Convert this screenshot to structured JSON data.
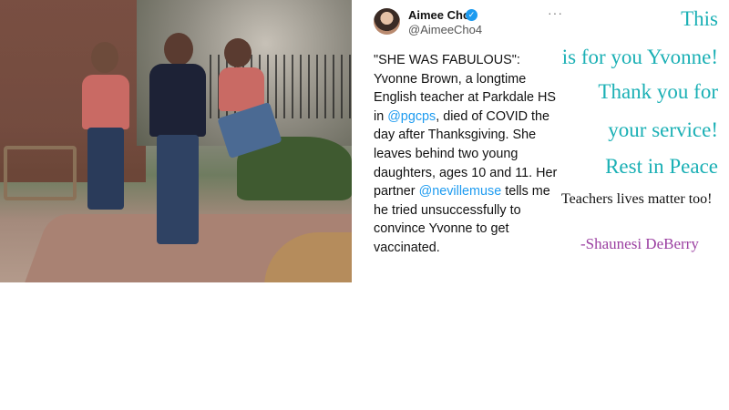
{
  "tweet": {
    "name": "Aimee Cho",
    "handle": "@AimeeCho4",
    "verified_icon": "verified-badge-icon",
    "more_icon": "ellipsis-icon",
    "text_part1": "\"SHE WAS FABULOUS\": Yvonne Brown, a longtime English teacher at Parkdale HS in ",
    "mention1": "@pgcps",
    "text_part2": ", died of COVID the day after Thanksgiving. She leaves behind two young daughters, ages 10 and 11. Her partner ",
    "mention2": "@nevillemuse",
    "text_part3": " tells me he tried unsuccessfully to convince Yvonne to get vaccinated.",
    "mention_color": "#1d9bf0"
  },
  "quote": {
    "line1": "This",
    "line2": "is for you Yvonne!",
    "line3": "Thank you for",
    "line4": "your service!",
    "line5": "Rest in Peace",
    "note": "Teachers lives matter too!",
    "signature": "-Shaunesi DeBerry",
    "accent_color": "#1bb0b5",
    "signature_color": "#9b3fa1"
  }
}
